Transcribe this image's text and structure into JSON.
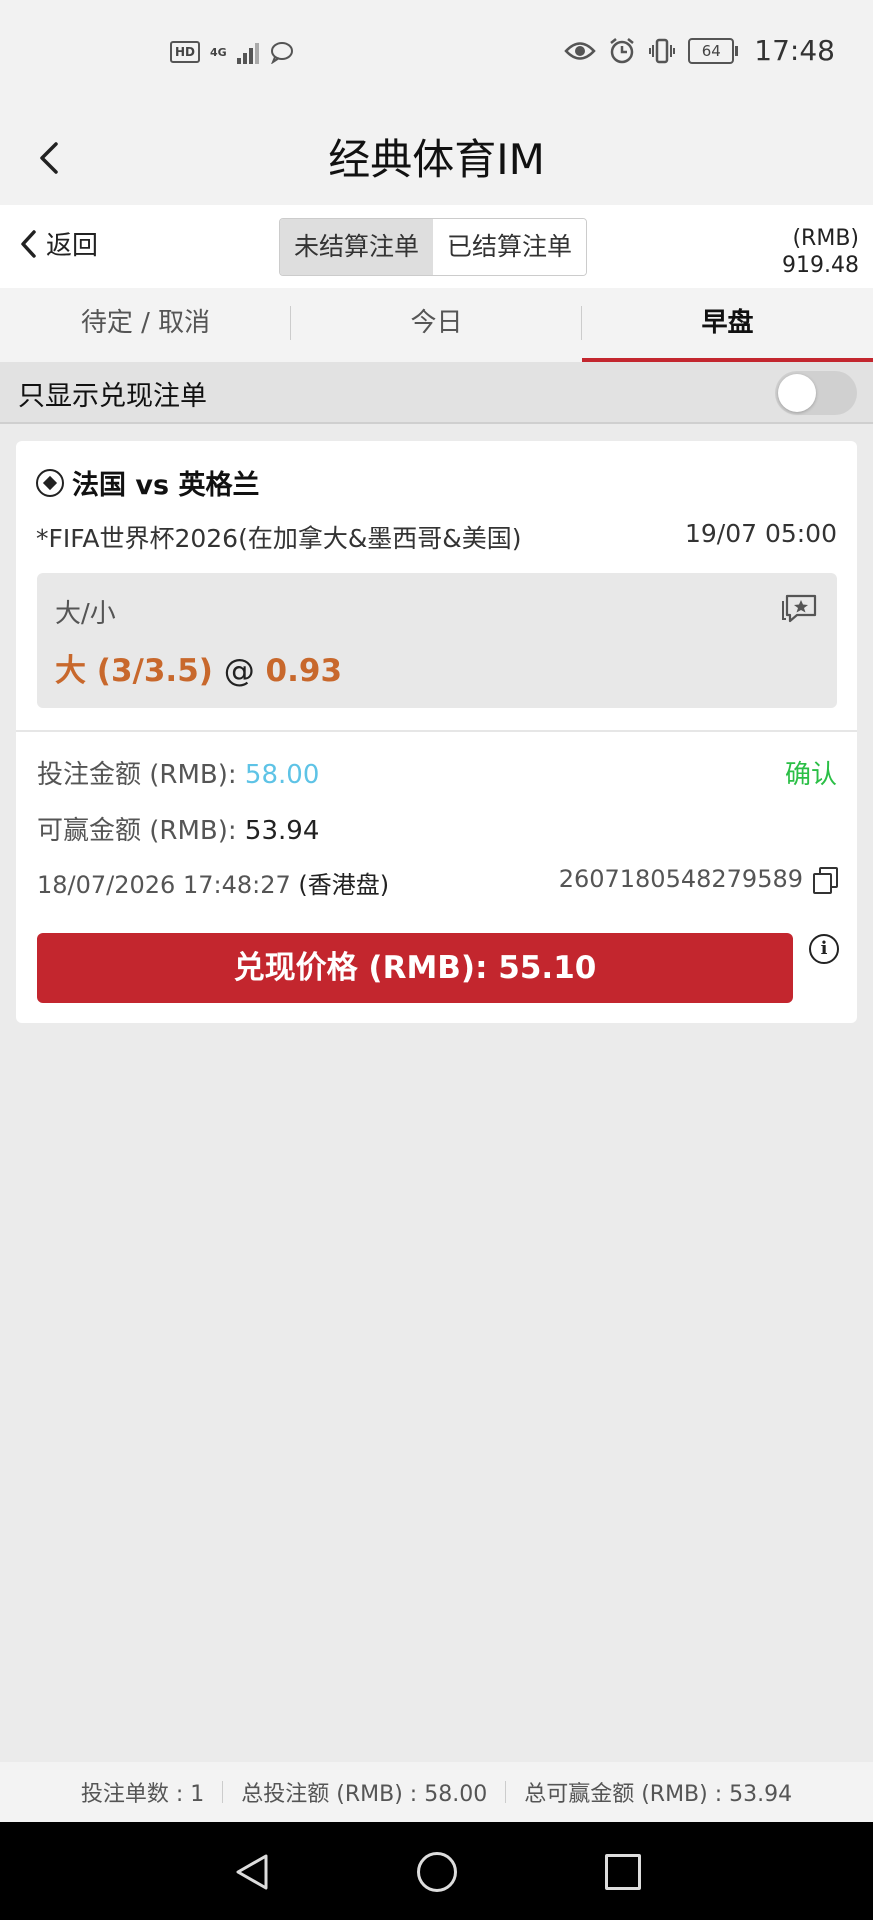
{
  "status_bar": {
    "time": "17:48",
    "battery": "64",
    "hd": "HD",
    "network": "4G"
  },
  "header": {
    "title": "经典体育IM"
  },
  "subheader": {
    "back_label": "返回",
    "segments": [
      "未结算注单",
      "已结算注单"
    ],
    "active_segment": "未结算注单",
    "currency": "(RMB)",
    "balance": "919.48"
  },
  "tabs": [
    {
      "label": "待定 / 取消",
      "active": false
    },
    {
      "label": "今日",
      "active": false
    },
    {
      "label": "早盘",
      "active": true
    }
  ],
  "filter": {
    "label": "只显示兑现注单",
    "enabled": false
  },
  "bet": {
    "match": "法国 vs 英格兰",
    "league": "*FIFA世界杯2026(在加拿大&墨西哥&美国)",
    "kickoff": "19/07 05:00",
    "market": "大/小",
    "selection": "大 (3/3.5)",
    "at": "@",
    "odds": "0.93",
    "stake_label": "投注金额 (RMB):",
    "stake": "58.00",
    "confirm": "确认",
    "win_label": "可赢金额 (RMB):",
    "win": "53.94",
    "placed_time": "18/07/2026 17:48:27",
    "odds_type": "(香港盘)",
    "bet_id": "2607180548279589",
    "cashout_label": "兑现价格 (RMB): 55.10"
  },
  "summary": {
    "count": "投注单数 : 1",
    "total_stake": "总投注额 (RMB) : 58.00",
    "total_win": "总可赢金额 (RMB) : 53.94"
  },
  "colors": {
    "accent": "#c3262e",
    "odds": "#c8682c",
    "stake": "#5ec3e6",
    "confirm": "#2bbf46"
  }
}
